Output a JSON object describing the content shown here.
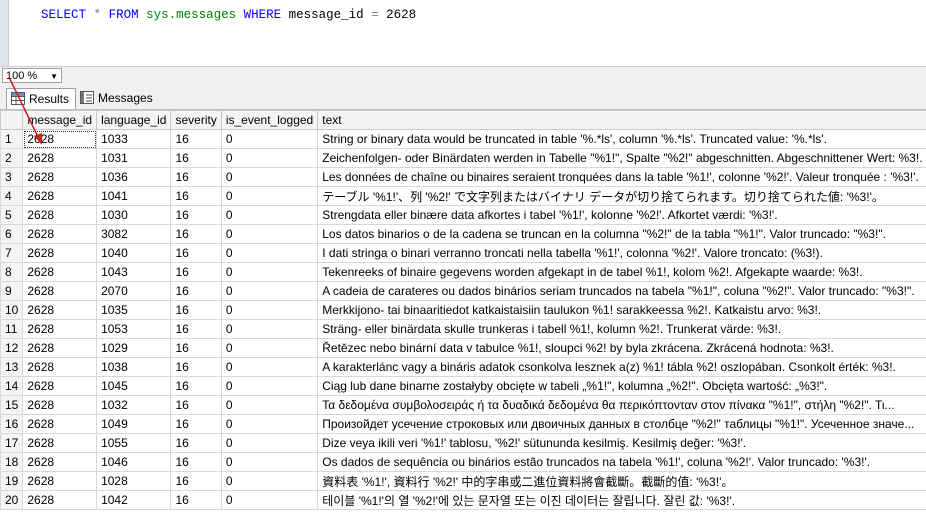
{
  "editor": {
    "sql_parts": [
      {
        "t": "SELECT",
        "c": "kw"
      },
      {
        "t": " ",
        "c": "txt"
      },
      {
        "t": "*",
        "c": "op"
      },
      {
        "t": " ",
        "c": "txt"
      },
      {
        "t": "FROM",
        "c": "kw"
      },
      {
        "t": " ",
        "c": "txt"
      },
      {
        "t": "sys.messages",
        "c": "obj"
      },
      {
        "t": " ",
        "c": "txt"
      },
      {
        "t": "WHERE",
        "c": "kw"
      },
      {
        "t": " message_id ",
        "c": "txt"
      },
      {
        "t": "=",
        "c": "op"
      },
      {
        "t": " 2628",
        "c": "num"
      }
    ]
  },
  "status": {
    "zoom_value": "100 %"
  },
  "tabs": {
    "results_label": "Results",
    "messages_label": "Messages"
  },
  "grid": {
    "columns": [
      "",
      "message_id",
      "language_id",
      "severity",
      "is_event_logged",
      "text"
    ],
    "rows": [
      [
        "1",
        "2628",
        "1033",
        "16",
        "0",
        "String or binary data would be truncated in table '%.*ls', column '%.*ls'. Truncated value: '%.*ls'."
      ],
      [
        "2",
        "2628",
        "1031",
        "16",
        "0",
        "Zeichenfolgen- oder Binärdaten werden in Tabelle \"%1!\", Spalte \"%2!\" abgeschnitten. Abgeschnittener Wert: %3!."
      ],
      [
        "3",
        "2628",
        "1036",
        "16",
        "0",
        "Les données de chaîne ou binaires seraient tronquées dans la table '%1!', colonne '%2!'. Valeur tronquée : '%3!'."
      ],
      [
        "4",
        "2628",
        "1041",
        "16",
        "0",
        "テーブル '%1!'、列 '%2!' で文字列またはバイナリ データが切り捨てられます。切り捨てられた値: '%3!'。"
      ],
      [
        "5",
        "2628",
        "1030",
        "16",
        "0",
        "Strengdata eller binære data afkortes i tabel '%1!', kolonne '%2!'. Afkortet værdi: '%3!'."
      ],
      [
        "6",
        "2628",
        "3082",
        "16",
        "0",
        "Los datos binarios o de la cadena se truncan en la columna \"%2!\" de la tabla \"%1!\". Valor truncado: \"%3!\"."
      ],
      [
        "7",
        "2628",
        "1040",
        "16",
        "0",
        "I dati stringa o binari verranno troncati nella tabella '%1!', colonna '%2!'. Valore troncato: (%3!)."
      ],
      [
        "8",
        "2628",
        "1043",
        "16",
        "0",
        "Tekenreeks of binaire gegevens worden afgekapt in de tabel %1!, kolom %2!. Afgekapte waarde: %3!."
      ],
      [
        "9",
        "2628",
        "2070",
        "16",
        "0",
        "A cadeia de carateres ou dados binários seriam truncados na tabela \"%1!\", coluna \"%2!\". Valor truncado: \"%3!\"."
      ],
      [
        "10",
        "2628",
        "1035",
        "16",
        "0",
        "Merkkijono- tai binaaritiedot katkaistaisiin taulukon %1! sarakkeessa %2!. Katkaistu arvo: %3!."
      ],
      [
        "11",
        "2628",
        "1053",
        "16",
        "0",
        "Sträng- eller binärdata skulle trunkeras i tabell %1!, kolumn %2!. Trunkerat värde: %3!."
      ],
      [
        "12",
        "2628",
        "1029",
        "16",
        "0",
        "Řetězec nebo binární data v tabulce %1!, sloupci %2! by byla zkrácena. Zkrácená hodnota: %3!."
      ],
      [
        "13",
        "2628",
        "1038",
        "16",
        "0",
        "A karakterlánc vagy a bináris adatok csonkolva lesznek a(z) %1! tábla %2! oszlopában. Csonkolt érték: %3!."
      ],
      [
        "14",
        "2628",
        "1045",
        "16",
        "0",
        "Ciąg lub dane binarne zostałyby obcięte w tabeli „%1!\", kolumna „%2!\". Obcięta wartość: „%3!\"."
      ],
      [
        "15",
        "2628",
        "1032",
        "16",
        "0",
        "Τα δεδομένα συμβολοσειράς ή τα δυαδικά δεδομένα θα περικόπτονταν στον πίνακα \"%1!\", στήλη \"%2!\". Τι..."
      ],
      [
        "16",
        "2628",
        "1049",
        "16",
        "0",
        "Произойдет усечение строковых или двоичных данных в столбце \"%2!\" таблицы \"%1!\". Усеченное значе..."
      ],
      [
        "17",
        "2628",
        "1055",
        "16",
        "0",
        "Dize veya ikili veri '%1!' tablosu, '%2!' sütununda kesilmiş. Kesilmiş değer: '%3!'."
      ],
      [
        "18",
        "2628",
        "1046",
        "16",
        "0",
        "Os dados de sequência ou binários estão truncados na tabela '%1!', coluna '%2!'. Valor truncado: '%3!'."
      ],
      [
        "19",
        "2628",
        "1028",
        "16",
        "0",
        "資料表 '%1!', 資料行 '%2!' 中的字串或二進位資料將會截斷。截斷的值: '%3!'。"
      ],
      [
        "20",
        "2628",
        "1042",
        "16",
        "0",
        "테이블 '%1!'의 열 '%2!'에 있는 문자열 또는 이진 데이터는 잘립니다. 잘린 값: '%3!'."
      ]
    ]
  },
  "colors": {
    "annotation_arrow": "#cc1f1f",
    "keyword": "#0000ff",
    "object": "#008000"
  }
}
